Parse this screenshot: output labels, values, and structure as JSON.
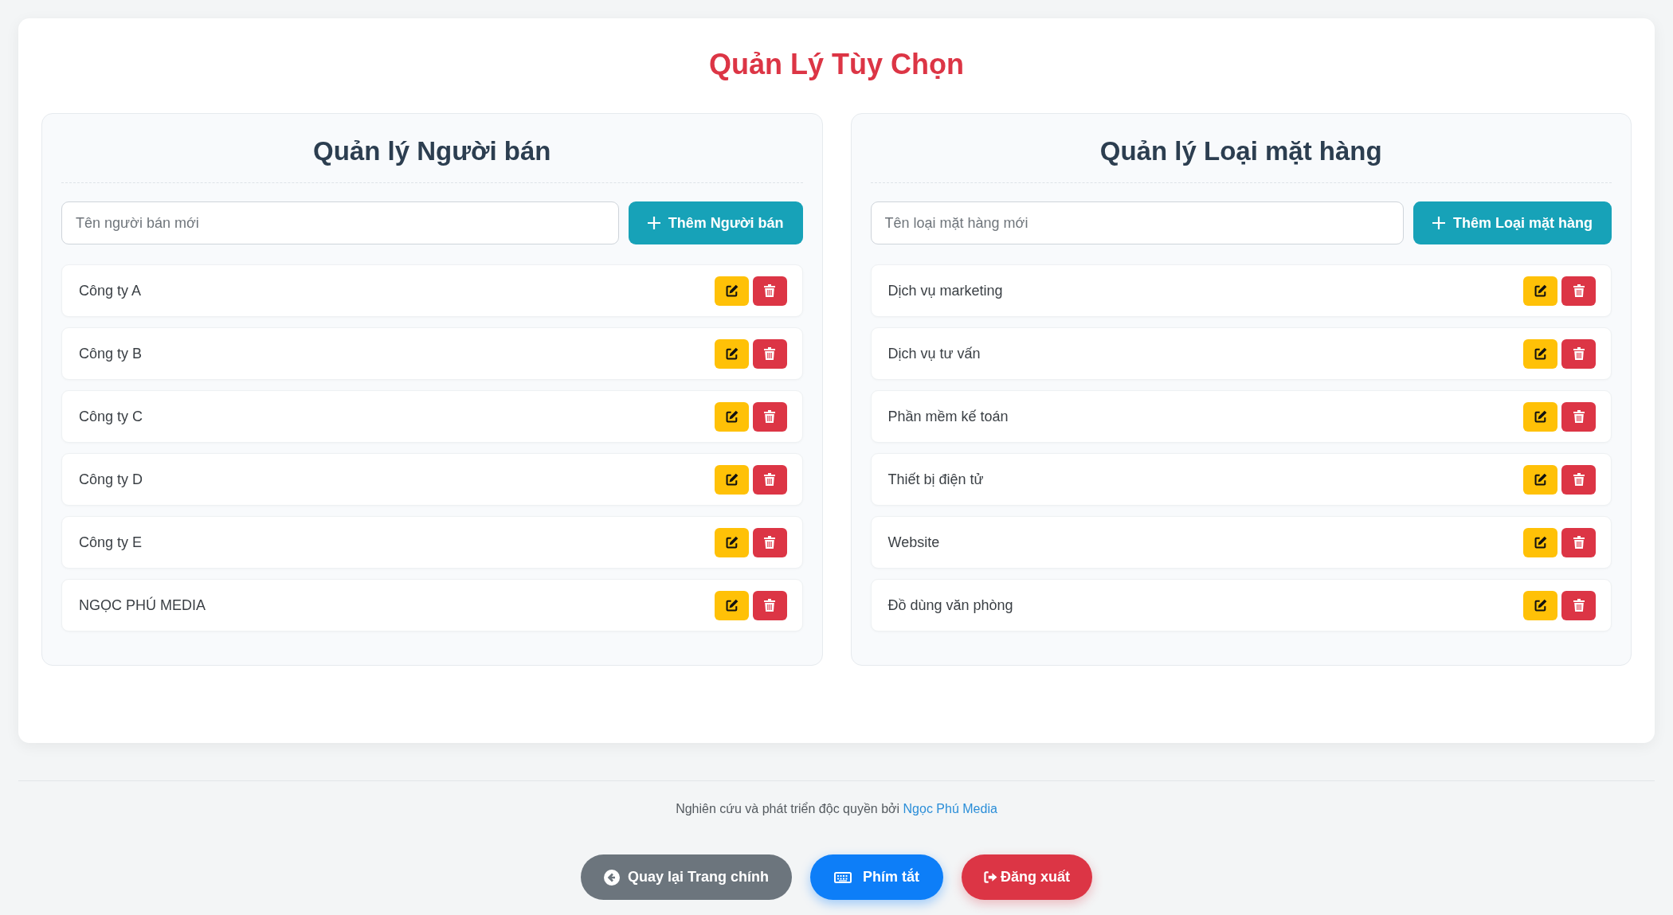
{
  "page_title": "Quản Lý Tùy Chọn",
  "panels": [
    {
      "title": "Quản lý Người bán",
      "input": {
        "placeholder": "Tên người bán mới"
      },
      "add_button": "Thêm Người bán",
      "items": [
        "Công ty A",
        "Công ty B",
        "Công ty C",
        "Công ty D",
        "Công ty E",
        "NGỌC PHÚ MEDIA"
      ]
    },
    {
      "title": "Quản lý Loại mặt hàng",
      "input": {
        "placeholder": "Tên loại mặt hàng mới"
      },
      "add_button": "Thêm Loại mặt hàng",
      "items": [
        "Dịch vụ marketing",
        "Dịch vụ tư vấn",
        "Phần mềm kế toán",
        "Thiết bị điện tử",
        "Website",
        "Đồ dùng văn phòng"
      ]
    }
  ],
  "footer": {
    "text": "Nghiên cứu và phát triển độc quyền bởi",
    "link": "Ngọc Phú Media"
  },
  "footer_buttons": [
    {
      "kind": "back",
      "label": "Quay lại Trang chính"
    },
    {
      "kind": "shortcuts",
      "label": "Phím tắt"
    },
    {
      "kind": "logout",
      "label": "Đăng xuất"
    }
  ]
}
